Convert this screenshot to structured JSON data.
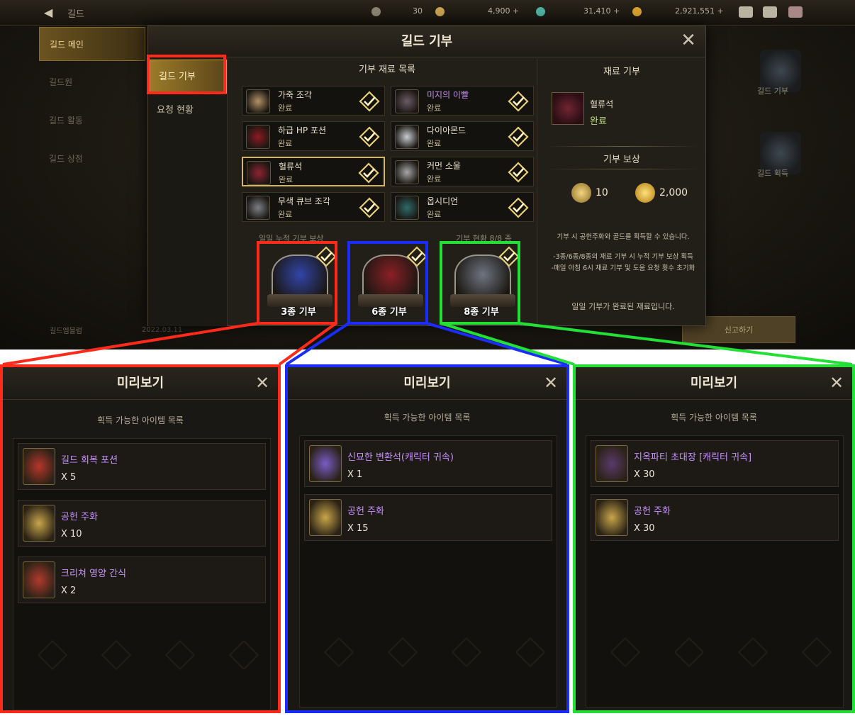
{
  "topbar": {
    "back_label": "길드",
    "currencies": [
      {
        "value": "30",
        "color": "#8c8470"
      },
      {
        "value": "4,900 +",
        "color": "#c7a250"
      },
      {
        "value": "31,410 +",
        "color": "#4fb0a0"
      },
      {
        "value": "2,921,551 +",
        "color": "#d8a030"
      }
    ]
  },
  "side_nav": {
    "items": [
      "길드 메인",
      "길드원",
      "길드 활동",
      "길드 상점"
    ],
    "footer": "길드엠블럼",
    "date": "2022.03.11"
  },
  "background_right": {
    "labels": [
      "길드 기부",
      "길드 획득"
    ],
    "report_button": "신고하기"
  },
  "modal": {
    "title": "길드 기부",
    "tabs": [
      "길드 기부",
      "요청 현황"
    ],
    "list_title": "기부 재료 목록",
    "materials": [
      {
        "name": "가죽 조각",
        "status": "완료",
        "rare": false,
        "color": "#b39266"
      },
      {
        "name": "미지의 이빨",
        "status": "완료",
        "rare": true,
        "color": "#6b5b66"
      },
      {
        "name": "하급 HP 포션",
        "status": "완료",
        "rare": false,
        "color": "#8c1a22"
      },
      {
        "name": "다이아몬드",
        "status": "완료",
        "rare": false,
        "color": "#c8cdd2"
      },
      {
        "name": "혈류석",
        "status": "완료",
        "rare": false,
        "color": "#8e2432"
      },
      {
        "name": "커먼 소울",
        "status": "완료",
        "rare": false,
        "color": "#a7a7a7"
      },
      {
        "name": "무색 큐브 조각",
        "status": "완료",
        "rare": false,
        "color": "#7b7f86"
      },
      {
        "name": "옵시디언",
        "status": "완료",
        "rare": false,
        "color": "#2f6b6a"
      }
    ],
    "daily_label": "일일 누적 기부 보상",
    "progress_label": "기부 현황 8/8 종",
    "chests": [
      {
        "label": "3종 기부",
        "color": "#3245a8"
      },
      {
        "label": "6종 기부",
        "color": "#8a2025"
      },
      {
        "label": "8종 기부",
        "color": "#6f7480"
      }
    ],
    "right": {
      "donate_title": "재료 기부",
      "item_name": "혈류석",
      "item_status": "완료",
      "reward_title": "기부 보상",
      "rewards": [
        {
          "value": "10",
          "icon": "contribution-coin-icon",
          "color": "#c9a64a"
        },
        {
          "value": "2,000",
          "icon": "gold-coin-icon",
          "color": "#e0b23a"
        }
      ],
      "note1": "기부 시 공헌주화와 골드를 획득할 수 있습니다.",
      "note2": "-3종/6종/8종의 재료 기부 시 누적 기부 보상 획득",
      "note3": "-매일 아침 6시 재료 기부 및 도움 요청 횟수 초기화",
      "done_text": "일일 기부가 완료된 재료입니다."
    }
  },
  "highlight_colors": {
    "red": "#ff2a1a",
    "blue": "#1a2cff",
    "green": "#22e035"
  },
  "previews": [
    {
      "title": "미리보기",
      "subtitle": "획득 가능한 아이템 목록",
      "items": [
        {
          "name": "길드 회복 포션",
          "qty": "X 5",
          "icon": "guild-potion-icon",
          "color": "#b8362a"
        },
        {
          "name": "공헌 주화",
          "qty": "X 10",
          "icon": "contribution-coin-icon",
          "color": "#c9a64a"
        },
        {
          "name": "크리쳐 영양 간식",
          "qty": "X 2",
          "icon": "creature-snack-icon",
          "color": "#b23a2e"
        }
      ]
    },
    {
      "title": "미리보기",
      "subtitle": "획득 가능한 아이템 목록",
      "items": [
        {
          "name": "신묘한 변환석(캐릭터 귀속)",
          "qty": "X 1",
          "icon": "crystal-icon",
          "color": "#7a5bc8"
        },
        {
          "name": "공헌 주화",
          "qty": "X 15",
          "icon": "contribution-coin-icon",
          "color": "#c9a64a"
        }
      ]
    },
    {
      "title": "미리보기",
      "subtitle": "획득 가능한 아이템 목록",
      "items": [
        {
          "name": "지옥파티 초대장 [캐릭터 귀속]",
          "qty": "X 30",
          "icon": "invitation-icon",
          "color": "#5a3a6a"
        },
        {
          "name": "공헌 주화",
          "qty": "X 30",
          "icon": "contribution-coin-icon",
          "color": "#c9a64a"
        }
      ]
    }
  ]
}
